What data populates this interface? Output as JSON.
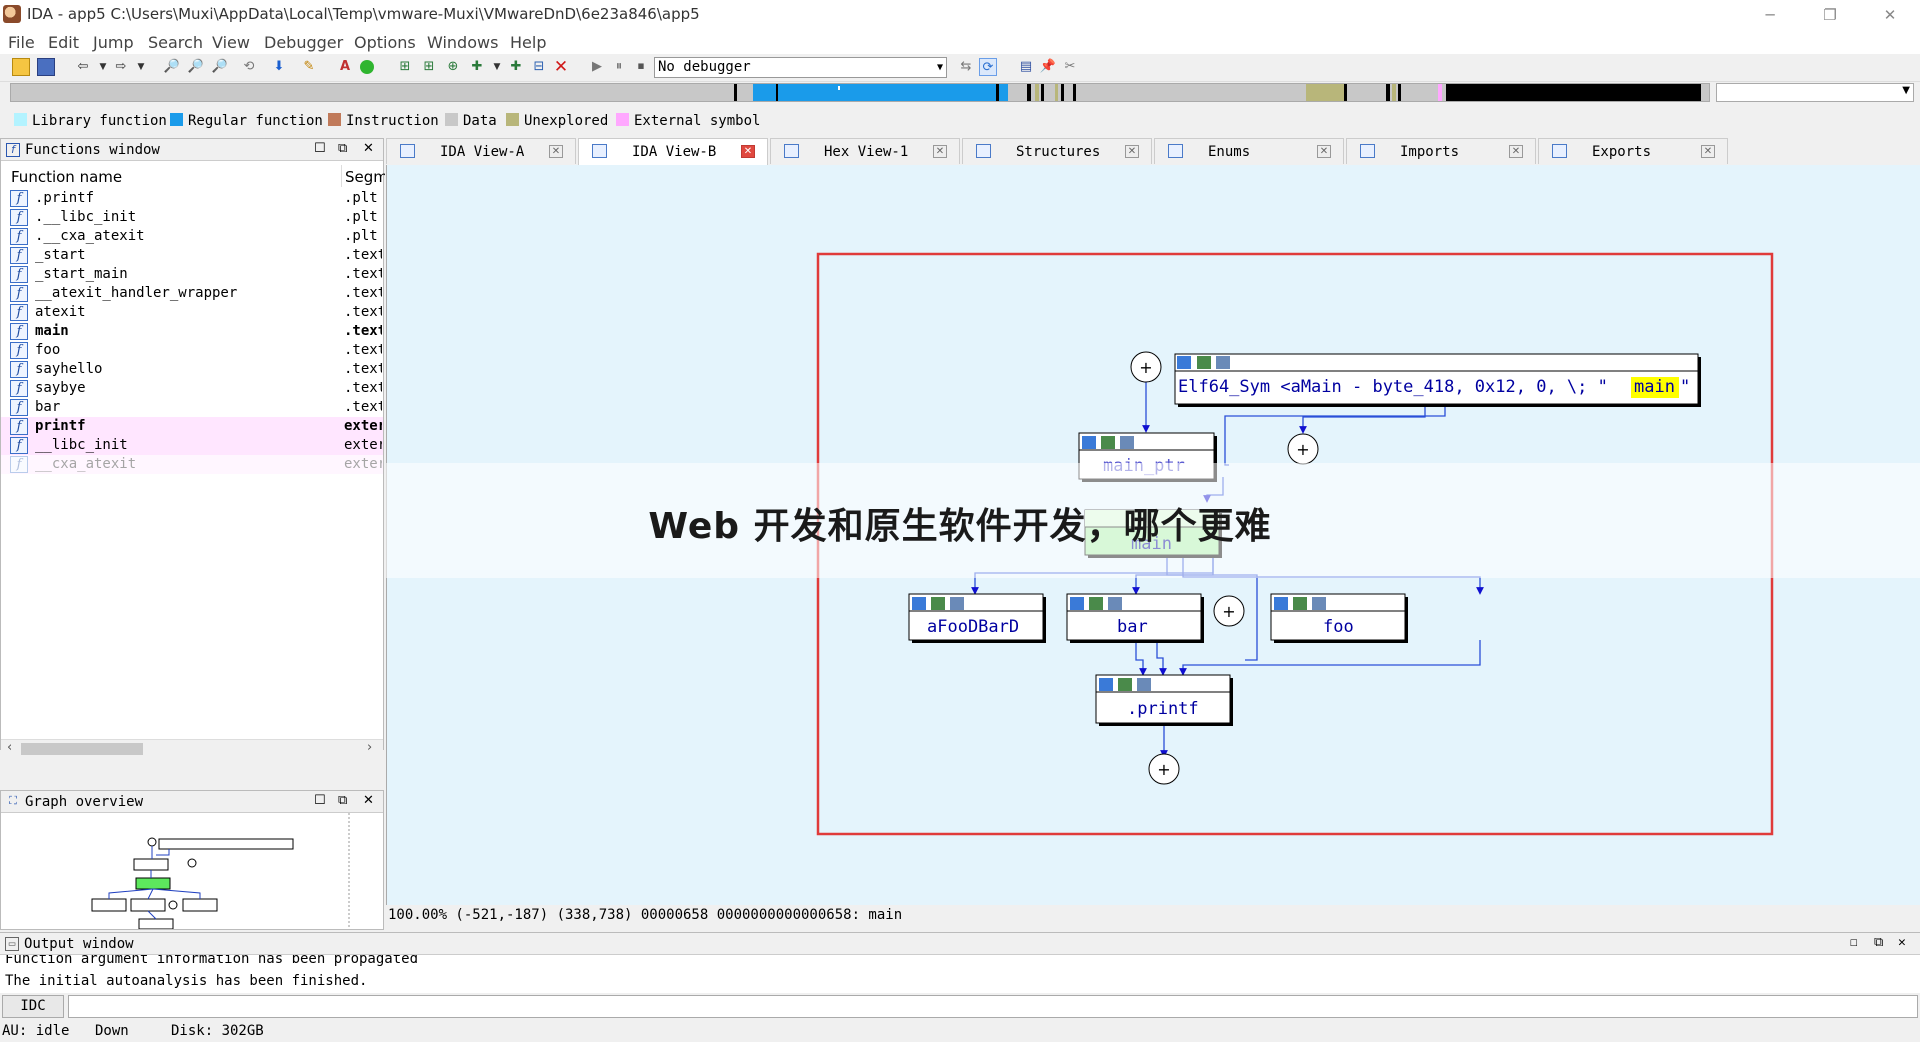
{
  "window": {
    "title": "IDA - app5 C:\\Users\\Muxi\\AppData\\Local\\Temp\\vmware-Muxi\\VMwareDnD\\6e23a846\\app5",
    "minimize": "─",
    "restore": "❐",
    "close": "✕"
  },
  "menu": [
    "File",
    "Edit",
    "Jump",
    "Search",
    "View",
    "Debugger",
    "Options",
    "Windows",
    "Help"
  ],
  "toolbar": {
    "debugger_select": "No debugger"
  },
  "legend": [
    {
      "label": "Library function",
      "color": "#b3f3ff"
    },
    {
      "label": "Regular function",
      "color": "#1a9bea"
    },
    {
      "label": "Instruction",
      "color": "#c07a5a"
    },
    {
      "label": "Data",
      "color": "#c8c8c8"
    },
    {
      "label": "Unexplored",
      "color": "#b8b67a"
    },
    {
      "label": "External symbol",
      "color": "#ffa8ff"
    }
  ],
  "functions_window": {
    "title": "Functions window",
    "col_name": "Function name",
    "col_segment": "Segment",
    "rows": [
      {
        "name": ".printf",
        "segment": ".plt"
      },
      {
        "name": ".__libc_init",
        "segment": ".plt"
      },
      {
        "name": ".__cxa_atexit",
        "segment": ".plt"
      },
      {
        "name": "_start",
        "segment": ".text"
      },
      {
        "name": "_start_main",
        "segment": ".text"
      },
      {
        "name": "__atexit_handler_wrapper",
        "segment": ".text"
      },
      {
        "name": "atexit",
        "segment": ".text"
      },
      {
        "name": "main",
        "segment": ".text"
      },
      {
        "name": "foo",
        "segment": ".text"
      },
      {
        "name": "sayhello",
        "segment": ".text"
      },
      {
        "name": "saybye",
        "segment": ".text"
      },
      {
        "name": "bar",
        "segment": ".text"
      },
      {
        "name": "printf",
        "segment": "extern"
      },
      {
        "name": "__libc_init",
        "segment": "extern"
      },
      {
        "name": "__cxa_atexit",
        "segment": "extern"
      }
    ]
  },
  "graph_overview": {
    "title": "Graph overview"
  },
  "tabs": [
    {
      "label": "IDA View-A",
      "active": false
    },
    {
      "label": "IDA View-B",
      "active": true
    },
    {
      "label": "Hex View-1",
      "active": false
    },
    {
      "label": "Structures",
      "active": false
    },
    {
      "label": "Enums",
      "active": false
    },
    {
      "label": "Imports",
      "active": false
    },
    {
      "label": "Exports",
      "active": false
    }
  ],
  "graph": {
    "nodes": {
      "elf_sym": {
        "prefix": "Elf64_Sym <aMain - byte_418, 0x12, 0, \\; \"",
        "highlight": "main",
        "suffix": "\""
      },
      "main_ptr": "main_ptr",
      "main": "main",
      "afoo": "aFooDBarD",
      "bar": "bar",
      "foo": "foo",
      "printf": ".printf"
    },
    "expand_glyph": "+"
  },
  "graph_status": "100.00% (-521,-187) (338,738) 00000658 0000000000000658: main",
  "banner": "Web 开发和原生软件开发，哪个更难",
  "output_window": {
    "title": "Output window",
    "lines": [
      "Function argument information has been propagated",
      "The initial autoanalysis has been finished."
    ]
  },
  "idc_button": "IDC",
  "statusbar": {
    "au": "AU:  idle",
    "direction": "Down",
    "disk": "Disk: 302GB"
  }
}
